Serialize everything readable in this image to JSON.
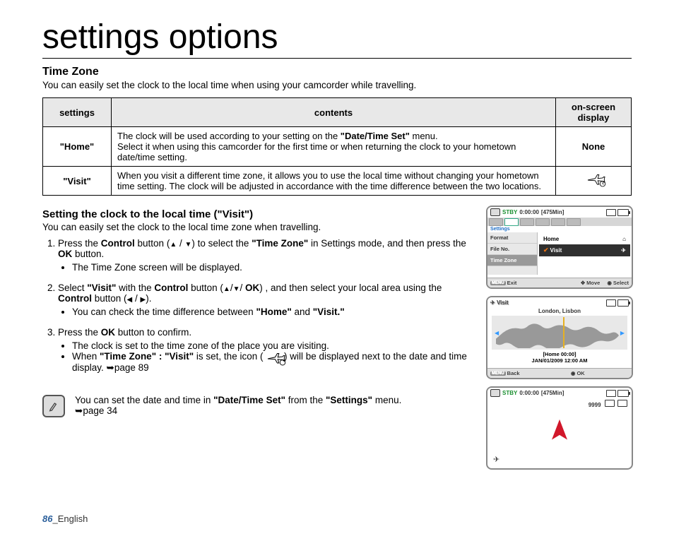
{
  "title": "settings options",
  "section": {
    "heading": "Time Zone",
    "intro": "You can easily set the clock to the local time when using your camcorder while travelling."
  },
  "table": {
    "headers": {
      "settings": "settings",
      "contents": "contents",
      "display": "on-screen display"
    },
    "rows": [
      {
        "setting": "\"Home\"",
        "contents_a": "The clock will be used according to your setting on the ",
        "contents_b": "\"Date/Time Set\"",
        "contents_c": " menu.",
        "contents_d": "Select it when using this camcorder for the first time or when returning the clock to your hometown date/time setting.",
        "display": "None"
      },
      {
        "setting": "\"Visit\"",
        "contents": "When you visit a different time zone, it allows you to use the local time without changing your hometown time setting. The clock will be adjusted in accordance with the time difference between the two locations.",
        "display_icon": "plane-clock-icon"
      }
    ]
  },
  "subsection": {
    "heading": "Setting the clock to the local time (\"Visit\")",
    "intro": "You can easily set the clock to the local time zone when travelling.",
    "steps": [
      {
        "pre": "Press the ",
        "b1": "Control",
        "mid1": " button (",
        "mid2": " / ",
        "mid3": ") to select the ",
        "b2": "\"Time Zone\"",
        "mid4": " in Settings mode, and then press the ",
        "b3": "OK",
        "tail": " button.",
        "bullet": "The Time Zone screen will be displayed."
      },
      {
        "pre": "Select ",
        "b1": "\"Visit\"",
        "mid1": " with the ",
        "b2": "Control",
        "mid2": " button (",
        "mid3": "/",
        "mid4": "/ ",
        "b3": "OK",
        "mid5": ") , and then select your local area using the ",
        "b4": "Control",
        "mid6": " button (",
        "mid7": " / ",
        "tail": ").",
        "bullet_a": "You can check the time difference between ",
        "bullet_b1": "\"Home\"",
        "bullet_c": " and ",
        "bullet_b2": "\"Visit.\""
      },
      {
        "pre": "Press the ",
        "b1": "OK",
        "tail": " button to confirm.",
        "bullet1": "The clock is set to the time zone of the place you are visiting.",
        "bullet2_a": "When ",
        "bullet2_b": "\"Time Zone\" : \"Visit\"",
        "bullet2_c": " is set, the icon ( ",
        "bullet2_d": " ) will be displayed next to the date and time display. ",
        "bullet2_e": "page 89"
      }
    ]
  },
  "note": {
    "text_a": "You can set the date and time in ",
    "text_b": "\"Date/Time Set\"",
    "text_c": " from the ",
    "text_d": "\"Settings\"",
    "text_e": " menu.",
    "page_ref": "page 34"
  },
  "footer": {
    "num": "86",
    "lang": "_English"
  },
  "osd1": {
    "status": "STBY",
    "time": "0:00:00",
    "remain": "[475Min]",
    "settings_label": "Settings",
    "side": [
      "Format",
      "File No.",
      "Time Zone"
    ],
    "side_selected": 2,
    "options": [
      {
        "label": "Home",
        "badge": "🏠"
      },
      {
        "label": "Visit",
        "badge": "✈"
      }
    ],
    "option_selected": 1,
    "menu_exit": "Exit",
    "menu_move": "Move",
    "menu_select": "Select",
    "menu_label": "MENU"
  },
  "osd2": {
    "title": "Visit",
    "city": "London, Lisbon",
    "home_time_label": "[Home 00:00]",
    "date": "JAN/01/2009 12:00 AM",
    "menu_back": "Back",
    "menu_ok": "OK",
    "menu_label": "MENU"
  },
  "osd3": {
    "status": "STBY",
    "time": "0:00:00",
    "remain": "[475Min]",
    "count": "9999"
  }
}
